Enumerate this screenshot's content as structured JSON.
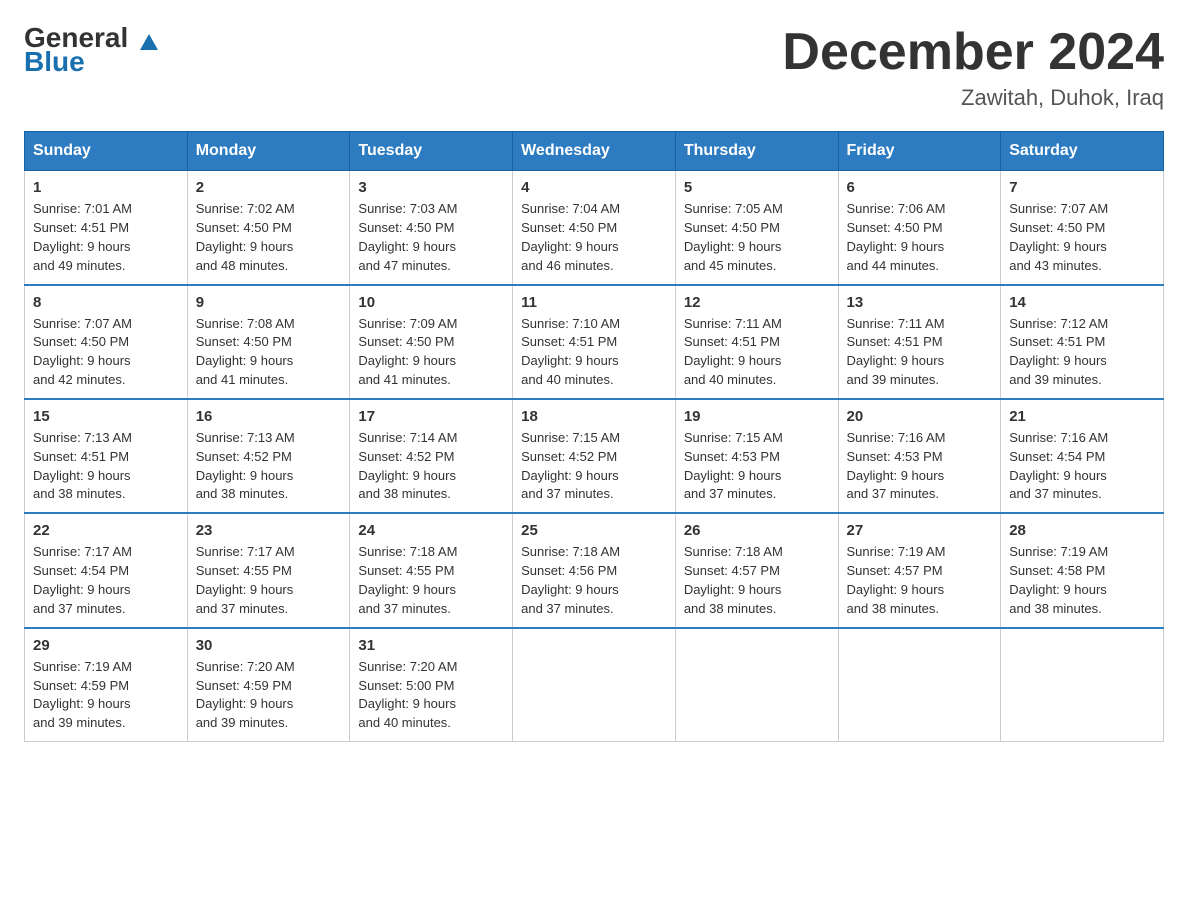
{
  "header": {
    "logo_general": "General",
    "logo_blue": "Blue",
    "main_title": "December 2024",
    "subtitle": "Zawitah, Duhok, Iraq"
  },
  "days_of_week": [
    "Sunday",
    "Monday",
    "Tuesday",
    "Wednesday",
    "Thursday",
    "Friday",
    "Saturday"
  ],
  "weeks": [
    [
      {
        "day": "1",
        "sunrise": "7:01 AM",
        "sunset": "4:51 PM",
        "daylight": "9 hours and 49 minutes."
      },
      {
        "day": "2",
        "sunrise": "7:02 AM",
        "sunset": "4:50 PM",
        "daylight": "9 hours and 48 minutes."
      },
      {
        "day": "3",
        "sunrise": "7:03 AM",
        "sunset": "4:50 PM",
        "daylight": "9 hours and 47 minutes."
      },
      {
        "day": "4",
        "sunrise": "7:04 AM",
        "sunset": "4:50 PM",
        "daylight": "9 hours and 46 minutes."
      },
      {
        "day": "5",
        "sunrise": "7:05 AM",
        "sunset": "4:50 PM",
        "daylight": "9 hours and 45 minutes."
      },
      {
        "day": "6",
        "sunrise": "7:06 AM",
        "sunset": "4:50 PM",
        "daylight": "9 hours and 44 minutes."
      },
      {
        "day": "7",
        "sunrise": "7:07 AM",
        "sunset": "4:50 PM",
        "daylight": "9 hours and 43 minutes."
      }
    ],
    [
      {
        "day": "8",
        "sunrise": "7:07 AM",
        "sunset": "4:50 PM",
        "daylight": "9 hours and 42 minutes."
      },
      {
        "day": "9",
        "sunrise": "7:08 AM",
        "sunset": "4:50 PM",
        "daylight": "9 hours and 41 minutes."
      },
      {
        "day": "10",
        "sunrise": "7:09 AM",
        "sunset": "4:50 PM",
        "daylight": "9 hours and 41 minutes."
      },
      {
        "day": "11",
        "sunrise": "7:10 AM",
        "sunset": "4:51 PM",
        "daylight": "9 hours and 40 minutes."
      },
      {
        "day": "12",
        "sunrise": "7:11 AM",
        "sunset": "4:51 PM",
        "daylight": "9 hours and 40 minutes."
      },
      {
        "day": "13",
        "sunrise": "7:11 AM",
        "sunset": "4:51 PM",
        "daylight": "9 hours and 39 minutes."
      },
      {
        "day": "14",
        "sunrise": "7:12 AM",
        "sunset": "4:51 PM",
        "daylight": "9 hours and 39 minutes."
      }
    ],
    [
      {
        "day": "15",
        "sunrise": "7:13 AM",
        "sunset": "4:51 PM",
        "daylight": "9 hours and 38 minutes."
      },
      {
        "day": "16",
        "sunrise": "7:13 AM",
        "sunset": "4:52 PM",
        "daylight": "9 hours and 38 minutes."
      },
      {
        "day": "17",
        "sunrise": "7:14 AM",
        "sunset": "4:52 PM",
        "daylight": "9 hours and 38 minutes."
      },
      {
        "day": "18",
        "sunrise": "7:15 AM",
        "sunset": "4:52 PM",
        "daylight": "9 hours and 37 minutes."
      },
      {
        "day": "19",
        "sunrise": "7:15 AM",
        "sunset": "4:53 PM",
        "daylight": "9 hours and 37 minutes."
      },
      {
        "day": "20",
        "sunrise": "7:16 AM",
        "sunset": "4:53 PM",
        "daylight": "9 hours and 37 minutes."
      },
      {
        "day": "21",
        "sunrise": "7:16 AM",
        "sunset": "4:54 PM",
        "daylight": "9 hours and 37 minutes."
      }
    ],
    [
      {
        "day": "22",
        "sunrise": "7:17 AM",
        "sunset": "4:54 PM",
        "daylight": "9 hours and 37 minutes."
      },
      {
        "day": "23",
        "sunrise": "7:17 AM",
        "sunset": "4:55 PM",
        "daylight": "9 hours and 37 minutes."
      },
      {
        "day": "24",
        "sunrise": "7:18 AM",
        "sunset": "4:55 PM",
        "daylight": "9 hours and 37 minutes."
      },
      {
        "day": "25",
        "sunrise": "7:18 AM",
        "sunset": "4:56 PM",
        "daylight": "9 hours and 37 minutes."
      },
      {
        "day": "26",
        "sunrise": "7:18 AM",
        "sunset": "4:57 PM",
        "daylight": "9 hours and 38 minutes."
      },
      {
        "day": "27",
        "sunrise": "7:19 AM",
        "sunset": "4:57 PM",
        "daylight": "9 hours and 38 minutes."
      },
      {
        "day": "28",
        "sunrise": "7:19 AM",
        "sunset": "4:58 PM",
        "daylight": "9 hours and 38 minutes."
      }
    ],
    [
      {
        "day": "29",
        "sunrise": "7:19 AM",
        "sunset": "4:59 PM",
        "daylight": "9 hours and 39 minutes."
      },
      {
        "day": "30",
        "sunrise": "7:20 AM",
        "sunset": "4:59 PM",
        "daylight": "9 hours and 39 minutes."
      },
      {
        "day": "31",
        "sunrise": "7:20 AM",
        "sunset": "5:00 PM",
        "daylight": "9 hours and 40 minutes."
      },
      null,
      null,
      null,
      null
    ]
  ]
}
